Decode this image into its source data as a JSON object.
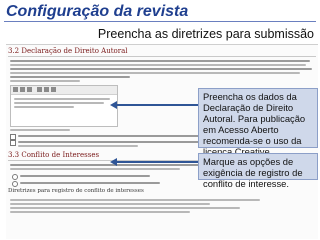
{
  "slide": {
    "title": "Configuração da revista",
    "subtitle": "Preencha as diretrizes para submissão"
  },
  "screenshot": {
    "section_copyright_title": "3.2 Declaração de Direito Autoral",
    "section_conflict_title": "3.3 Conflito de Interesses",
    "bottom_heading": "Diretrizes para registro de conflito de interesses"
  },
  "callouts": {
    "copyright": "Preencha os dados da Declaração de Direito Autoral. Para publicação em Acesso Aberto recomenda-se o uso da licença Creative Commons.",
    "conflict": "Marque as opções de exigência de registro de conflito de interesse."
  },
  "colors": {
    "title": "#1f3f8f",
    "callout_bg": "#cfd8ea",
    "arrow": "#2f5596",
    "section_title": "#7a1a1a"
  }
}
